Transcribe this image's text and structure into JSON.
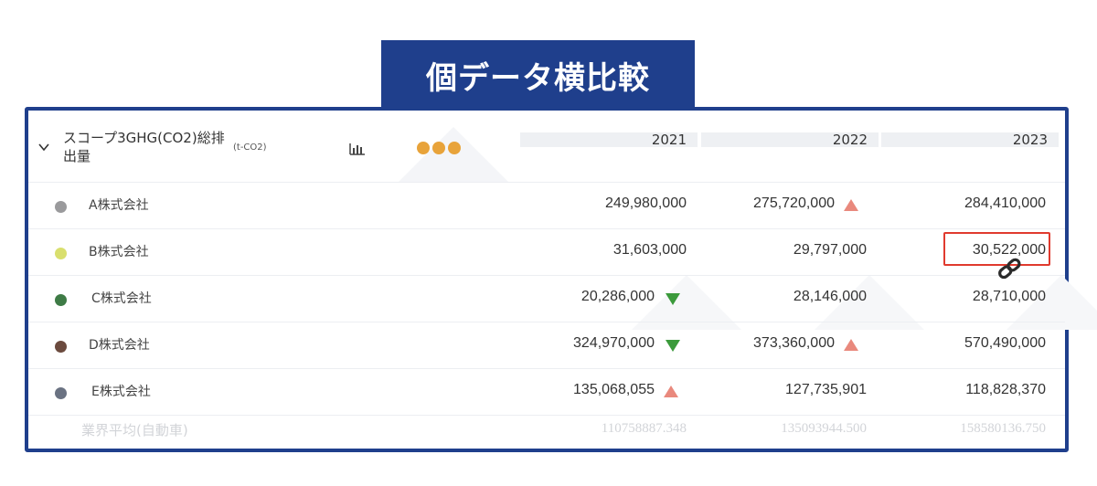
{
  "title": "個データ横比較",
  "metric": {
    "label": "スコープ3GHG(CO2)総排出量",
    "unit": "(t-CO2)"
  },
  "icons": {
    "collapse": "chevron-down-icon",
    "chart": "bar-chart-icon",
    "more": "more-dots-icon",
    "link": "link-icon"
  },
  "years": [
    "2021",
    "2022",
    "2023"
  ],
  "companies": [
    {
      "name": "A株式会社",
      "color": "#9a9a9c",
      "values": [
        "249,980,000",
        "275,720,000",
        "284,410,000"
      ],
      "trend": [
        "",
        "up",
        ""
      ]
    },
    {
      "name": "B株式会社",
      "color": "#d9df6e",
      "values": [
        "31,603,000",
        "29,797,000",
        "30,522,000"
      ],
      "trend": [
        "",
        "",
        ""
      ]
    },
    {
      "name": "C株式会社",
      "color": "#3e7b46",
      "values": [
        "20,286,000",
        "28,146,000",
        "28,710,000"
      ],
      "trend": [
        "down",
        "",
        ""
      ]
    },
    {
      "name": "D株式会社",
      "color": "#6b4a3e",
      "values": [
        "324,970,000",
        "373,360,000",
        "570,490,000"
      ],
      "trend": [
        "down",
        "up",
        ""
      ]
    },
    {
      "name": "E株式会社",
      "color": "#6a7282",
      "values": [
        "135,068,055",
        "127,735,901",
        "118,828,370"
      ],
      "trend": [
        "up",
        "",
        ""
      ]
    }
  ],
  "industry_average": {
    "label": "業界平均(自動車)",
    "values": [
      "110758887.348",
      "135093944.500",
      "158580136.750"
    ]
  },
  "colors": {
    "accent": "#1f3f8c",
    "dots": "#e8a33a",
    "up": "#e9897d",
    "down": "#3b9a3b",
    "highlight": "#e03a2e"
  }
}
